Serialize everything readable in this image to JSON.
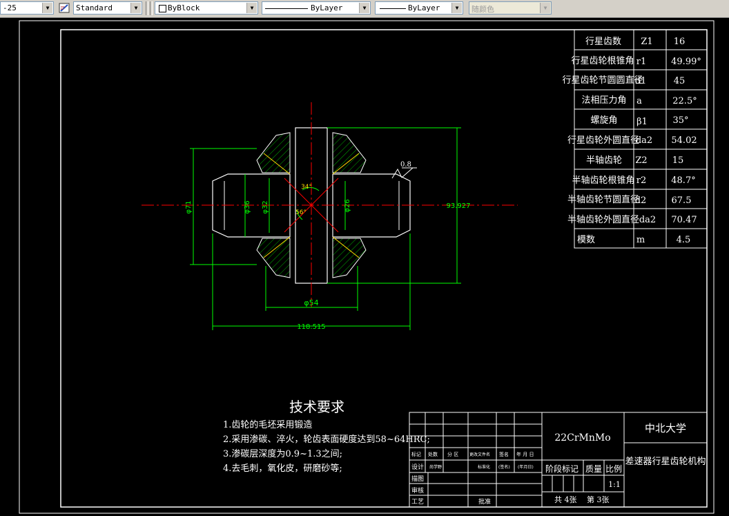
{
  "toolbar": {
    "dimstyle_value": "-25",
    "textstyle_value": "Standard",
    "color_value": "ByBlock",
    "linetype_value": "ByLayer",
    "lineweight_value": "ByLayer",
    "plotstyle_value": "随颜色"
  },
  "dims": {
    "d71": "φ71",
    "d36": "φ36",
    "d32": "φ32",
    "d26": "φ26",
    "d54": "φ54",
    "len118": "118.515",
    "len93": "93.927",
    "ang34": "34°",
    "ang56": "56°",
    "rough": "0.8"
  },
  "param_table": [
    {
      "name": "行星齿数",
      "sym": "Z1",
      "val": "16"
    },
    {
      "name": "行星齿轮根锥角",
      "sym": "r1",
      "val": "49.99°"
    },
    {
      "name": "行星齿轮节圆圆直径",
      "sym": "d1",
      "val": "45"
    },
    {
      "name": "法相压力角",
      "sym": "a",
      "val": "22.5°"
    },
    {
      "name": "螺旋角",
      "sym": "β1",
      "val": "35°"
    },
    {
      "name": "行星齿轮外圆直径",
      "sym": "da2",
      "val": "54.02"
    },
    {
      "name": "半轴齿轮",
      "sym": "Z2",
      "val": "15"
    },
    {
      "name": "半轴齿轮根锥角",
      "sym": "r2",
      "val": "48.7°"
    },
    {
      "name": "半轴齿轮节圆直径",
      "sym": "d2",
      "val": "67.5"
    },
    {
      "name": "半轴齿轮外圆直径",
      "sym": "da2",
      "val": "70.47"
    },
    {
      "name": "模数",
      "sym": "m",
      "val": "4.5"
    }
  ],
  "tech": {
    "title": "技术要求",
    "lines": [
      "1.齿轮的毛坯采用锻造",
      "2.采用渗碳、淬火，轮齿表面硬度达到58~64HRC;",
      "3.渗碳层深度为0.9~1.3之间;",
      "4.去毛刺，氧化皮，研磨砂等;"
    ]
  },
  "title_block": {
    "material": "22CrMnMo",
    "school": "中北大学",
    "drawing_name": "差速器行星齿轮机构",
    "stage_mark": "阶段标记",
    "weight": "质量",
    "scale_label": "比例",
    "scale": "1:1",
    "total_sheets": "共 4张",
    "sheet_no": "第 3张",
    "hdr_mark": "标记",
    "hdr_count": "处数",
    "hdr_zone": "分 区",
    "hdr_docno": "更改文件名",
    "hdr_sign": "签名",
    "hdr_date": "年 月 日",
    "design": "设计",
    "designer": "尚学野",
    "standard": "标准化",
    "sign2": "(签名)",
    "date2": "(年月日)",
    "draw": "描图",
    "check": "审核",
    "process": "工艺",
    "approve": "批准"
  }
}
